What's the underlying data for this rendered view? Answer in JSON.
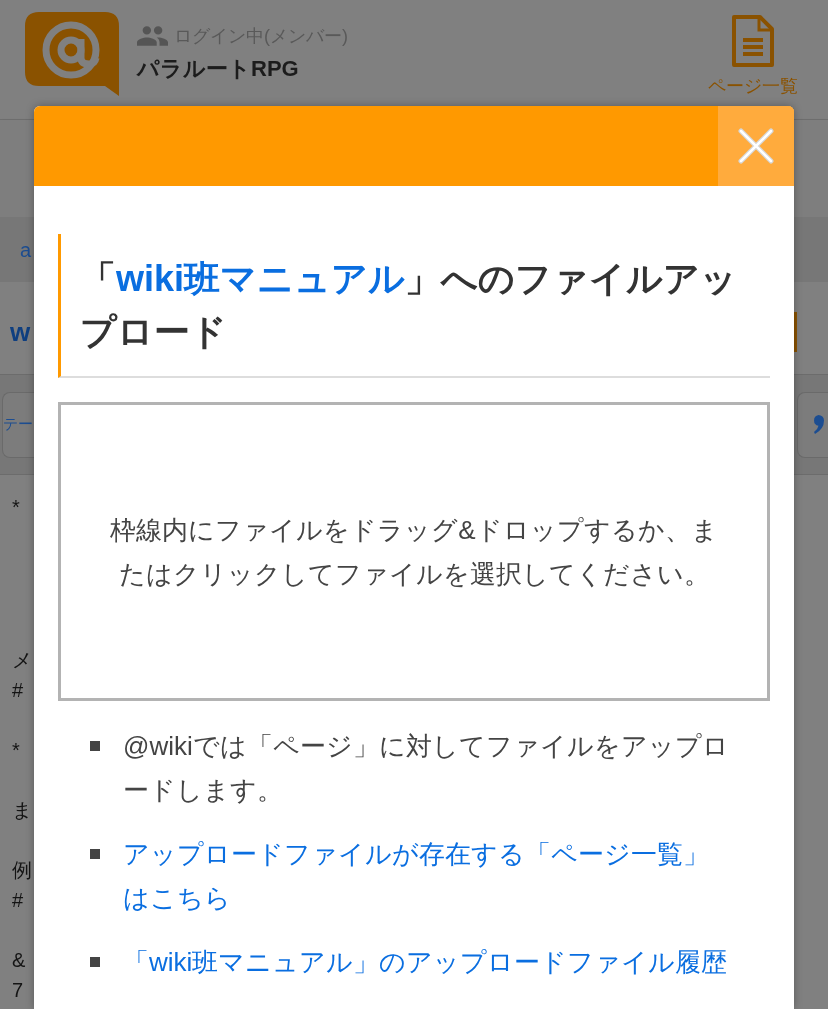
{
  "header": {
    "login_status": "ログイン中(メンバー)",
    "site_name": "パラルートRPG",
    "page_list_label": "ページ一覧"
  },
  "background_page": {
    "breadcrumb": "a",
    "page_title": "w",
    "toolbar_button": "テー",
    "text_blocks": [
      [
        "*"
      ],
      [
        "メ",
        "#"
      ],
      [
        "*"
      ],
      [
        "ま"
      ],
      [
        "例",
        "#"
      ],
      [
        "&",
        "7"
      ]
    ]
  },
  "dialog": {
    "title": {
      "before": "「",
      "link": "wiki班マニュアル",
      "after": "」へのファイルアップロード"
    },
    "drop_zone": "枠線内にファイルをドラッグ&ドロップするか、またはクリックしてファイルを選択してください。",
    "notes": [
      {
        "kind": "text",
        "text": "@wikiでは「ページ」に対してファイルをアップロードします。"
      },
      {
        "kind": "link",
        "text": "アップロードファイルが存在する「ページ一覧」はこちら"
      },
      {
        "kind": "link",
        "text": "「wiki班マニュアル」のアップロードファイル履歴"
      }
    ]
  }
}
